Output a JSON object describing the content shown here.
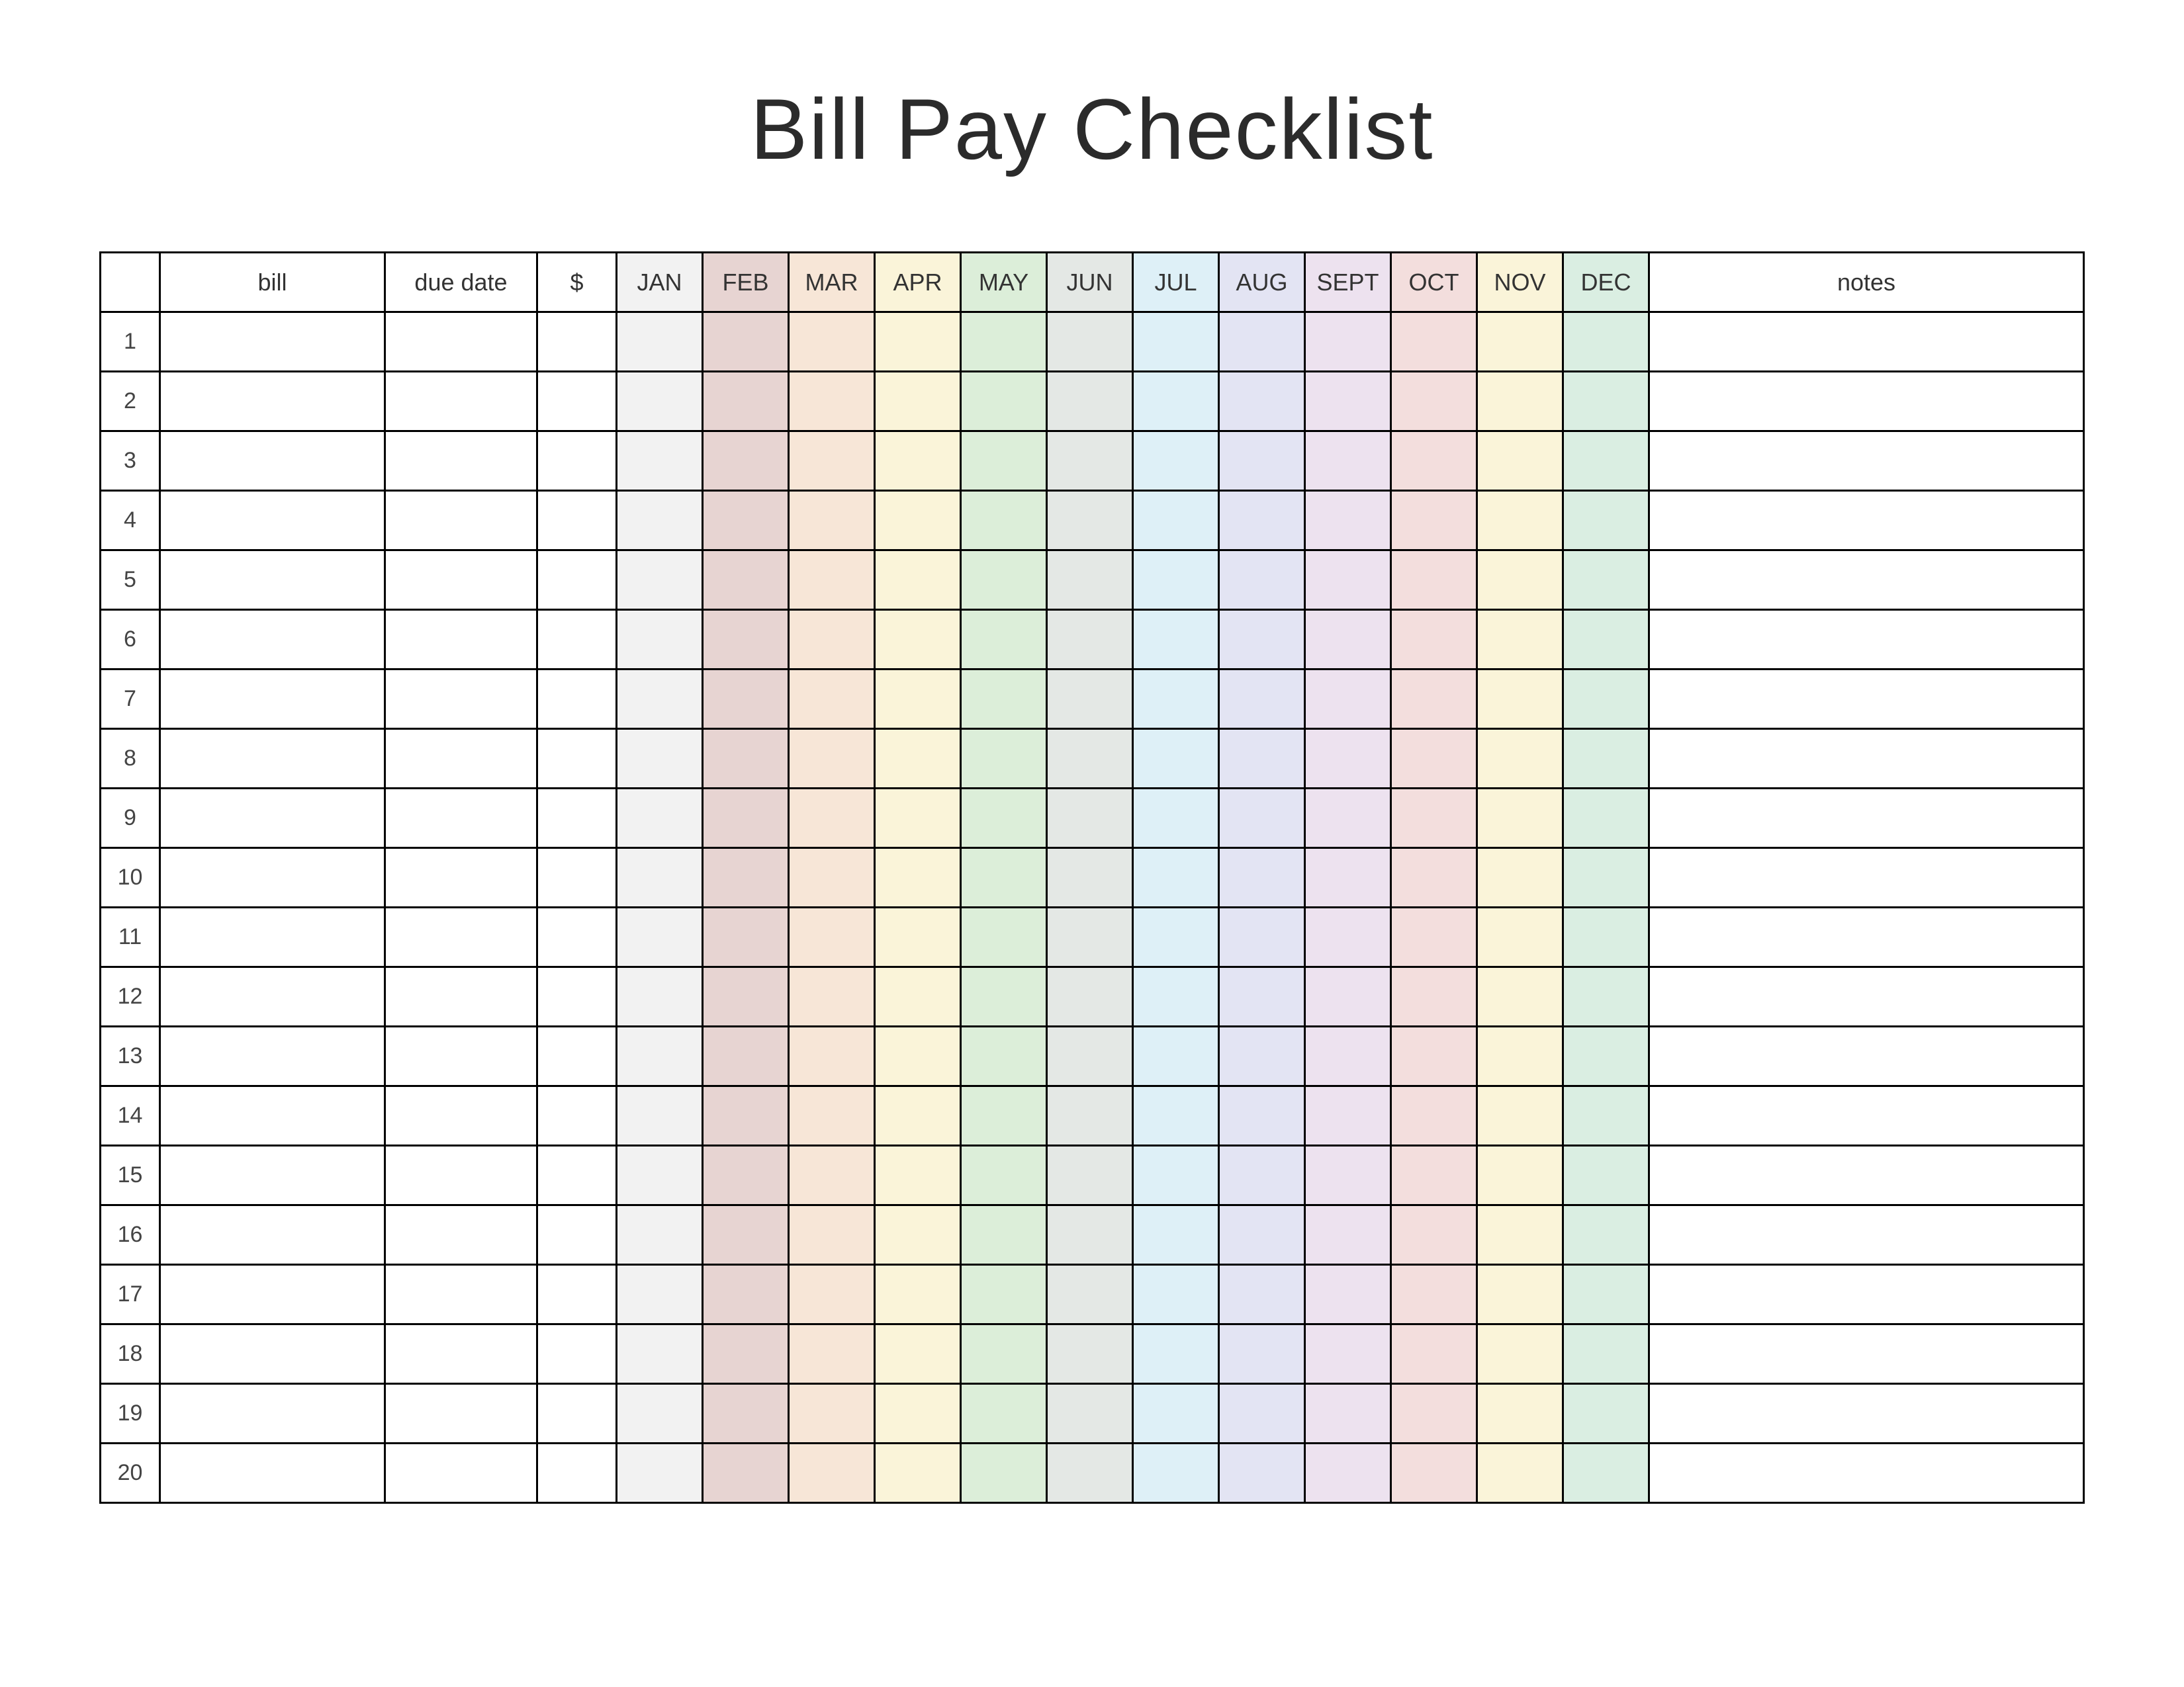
{
  "title": "Bill Pay Checklist",
  "headers": {
    "num": "",
    "bill": "bill",
    "due": "due date",
    "amt": "$",
    "months": [
      "JAN",
      "FEB",
      "MAR",
      "APR",
      "MAY",
      "JUN",
      "JUL",
      "AUG",
      "SEPT",
      "OCT",
      "NOV",
      "DEC"
    ],
    "notes": "notes"
  },
  "rows": [
    {
      "num": "1",
      "bill": "",
      "due": "",
      "amt": "",
      "months": [
        "",
        "",
        "",
        "",
        "",
        "",
        "",
        "",
        "",
        "",
        "",
        ""
      ],
      "notes": ""
    },
    {
      "num": "2",
      "bill": "",
      "due": "",
      "amt": "",
      "months": [
        "",
        "",
        "",
        "",
        "",
        "",
        "",
        "",
        "",
        "",
        "",
        ""
      ],
      "notes": ""
    },
    {
      "num": "3",
      "bill": "",
      "due": "",
      "amt": "",
      "months": [
        "",
        "",
        "",
        "",
        "",
        "",
        "",
        "",
        "",
        "",
        "",
        ""
      ],
      "notes": ""
    },
    {
      "num": "4",
      "bill": "",
      "due": "",
      "amt": "",
      "months": [
        "",
        "",
        "",
        "",
        "",
        "",
        "",
        "",
        "",
        "",
        "",
        ""
      ],
      "notes": ""
    },
    {
      "num": "5",
      "bill": "",
      "due": "",
      "amt": "",
      "months": [
        "",
        "",
        "",
        "",
        "",
        "",
        "",
        "",
        "",
        "",
        "",
        ""
      ],
      "notes": ""
    },
    {
      "num": "6",
      "bill": "",
      "due": "",
      "amt": "",
      "months": [
        "",
        "",
        "",
        "",
        "",
        "",
        "",
        "",
        "",
        "",
        "",
        ""
      ],
      "notes": ""
    },
    {
      "num": "7",
      "bill": "",
      "due": "",
      "amt": "",
      "months": [
        "",
        "",
        "",
        "",
        "",
        "",
        "",
        "",
        "",
        "",
        "",
        ""
      ],
      "notes": ""
    },
    {
      "num": "8",
      "bill": "",
      "due": "",
      "amt": "",
      "months": [
        "",
        "",
        "",
        "",
        "",
        "",
        "",
        "",
        "",
        "",
        "",
        ""
      ],
      "notes": ""
    },
    {
      "num": "9",
      "bill": "",
      "due": "",
      "amt": "",
      "months": [
        "",
        "",
        "",
        "",
        "",
        "",
        "",
        "",
        "",
        "",
        "",
        ""
      ],
      "notes": ""
    },
    {
      "num": "10",
      "bill": "",
      "due": "",
      "amt": "",
      "months": [
        "",
        "",
        "",
        "",
        "",
        "",
        "",
        "",
        "",
        "",
        "",
        ""
      ],
      "notes": ""
    },
    {
      "num": "11",
      "bill": "",
      "due": "",
      "amt": "",
      "months": [
        "",
        "",
        "",
        "",
        "",
        "",
        "",
        "",
        "",
        "",
        "",
        ""
      ],
      "notes": ""
    },
    {
      "num": "12",
      "bill": "",
      "due": "",
      "amt": "",
      "months": [
        "",
        "",
        "",
        "",
        "",
        "",
        "",
        "",
        "",
        "",
        "",
        ""
      ],
      "notes": ""
    },
    {
      "num": "13",
      "bill": "",
      "due": "",
      "amt": "",
      "months": [
        "",
        "",
        "",
        "",
        "",
        "",
        "",
        "",
        "",
        "",
        "",
        ""
      ],
      "notes": ""
    },
    {
      "num": "14",
      "bill": "",
      "due": "",
      "amt": "",
      "months": [
        "",
        "",
        "",
        "",
        "",
        "",
        "",
        "",
        "",
        "",
        "",
        ""
      ],
      "notes": ""
    },
    {
      "num": "15",
      "bill": "",
      "due": "",
      "amt": "",
      "months": [
        "",
        "",
        "",
        "",
        "",
        "",
        "",
        "",
        "",
        "",
        "",
        ""
      ],
      "notes": ""
    },
    {
      "num": "16",
      "bill": "",
      "due": "",
      "amt": "",
      "months": [
        "",
        "",
        "",
        "",
        "",
        "",
        "",
        "",
        "",
        "",
        "",
        ""
      ],
      "notes": ""
    },
    {
      "num": "17",
      "bill": "",
      "due": "",
      "amt": "",
      "months": [
        "",
        "",
        "",
        "",
        "",
        "",
        "",
        "",
        "",
        "",
        "",
        ""
      ],
      "notes": ""
    },
    {
      "num": "18",
      "bill": "",
      "due": "",
      "amt": "",
      "months": [
        "",
        "",
        "",
        "",
        "",
        "",
        "",
        "",
        "",
        "",
        "",
        ""
      ],
      "notes": ""
    },
    {
      "num": "19",
      "bill": "",
      "due": "",
      "amt": "",
      "months": [
        "",
        "",
        "",
        "",
        "",
        "",
        "",
        "",
        "",
        "",
        "",
        ""
      ],
      "notes": ""
    },
    {
      "num": "20",
      "bill": "",
      "due": "",
      "amt": "",
      "months": [
        "",
        "",
        "",
        "",
        "",
        "",
        "",
        "",
        "",
        "",
        "",
        ""
      ],
      "notes": ""
    }
  ]
}
